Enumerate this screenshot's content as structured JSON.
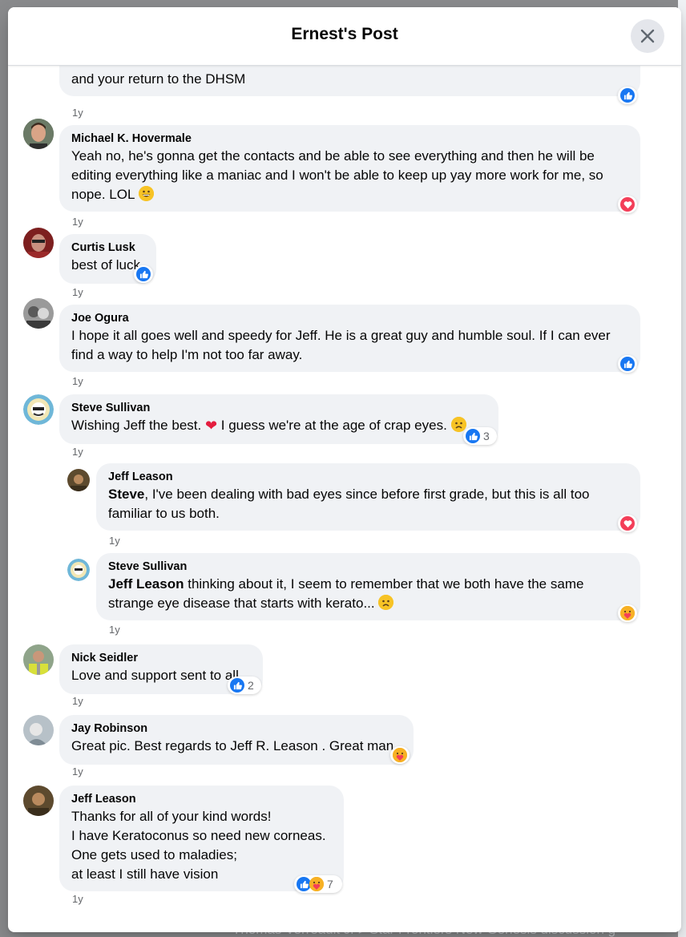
{
  "header": {
    "title": "Ernest's Post"
  },
  "background": {
    "footer_text": "Thomas Verreault Jr ▸ Star Frontiers New Genesis discussion g"
  },
  "comments": [
    {
      "id": "c0",
      "text_tail": "and your return to the DHSM",
      "time": "1y",
      "reactions": [
        "like"
      ]
    },
    {
      "id": "c1",
      "author": "Michael K. Hovermale",
      "text": "Yeah no, he's gonna get the contacts and be able to see everything and then he will be editing everything like a maniac and I won't be able to keep up yay more work for me, so nope. LOL",
      "time": "1y",
      "reactions": [
        "love"
      ]
    },
    {
      "id": "c2",
      "author": "Curtis Lusk",
      "text": "best of luck",
      "time": "1y",
      "reactions": [
        "like"
      ]
    },
    {
      "id": "c3",
      "author": "Joe Ogura",
      "text": "I hope it all goes well and speedy for Jeff. He is a great guy and humble soul. If I can ever find a way to help I'm not too far away.",
      "time": "1y",
      "reactions": [
        "like"
      ]
    },
    {
      "id": "c4",
      "author": "Steve Sullivan",
      "text_a": "Wishing Jeff the best.",
      "text_b": "I guess we're at the age of crap eyes.",
      "time": "1y",
      "reactions": [
        "like"
      ],
      "reaction_count": "3"
    },
    {
      "id": "c5",
      "author": "Jeff Leason",
      "mention": "Steve",
      "text": ", I've been dealing with bad eyes since before first grade, but this is all too familiar to us both.",
      "time": "1y",
      "reactions": [
        "love"
      ]
    },
    {
      "id": "c6",
      "author": "Steve Sullivan",
      "mention": "Jeff Leason",
      "text": "thinking about it, I seem to remember that we both have the same strange eye disease that starts with kerato...",
      "time": "1y",
      "reactions": [
        "care"
      ]
    },
    {
      "id": "c7",
      "author": "Nick Seidler",
      "text": "Love and support sent to all.",
      "time": "1y",
      "reactions": [
        "like"
      ],
      "reaction_count": "2"
    },
    {
      "id": "c8",
      "author": "Jay Robinson",
      "text": "Great pic. Best regards to Jeff R. Leason . Great man.",
      "time": "1y",
      "reactions": [
        "care"
      ]
    },
    {
      "id": "c9",
      "author": "Jeff Leason",
      "lines": [
        "Thanks for all of your kind words!",
        "I have Keratoconus so need new corneas.",
        "One gets used to maladies;",
        "at least I still have vision"
      ],
      "time": "1y",
      "reactions": [
        "like",
        "care"
      ],
      "reaction_count": "7"
    }
  ],
  "colors": {
    "like": "#1877f2",
    "love": "#f33e58",
    "care": "#f7b125",
    "bubble": "#f0f2f5"
  }
}
